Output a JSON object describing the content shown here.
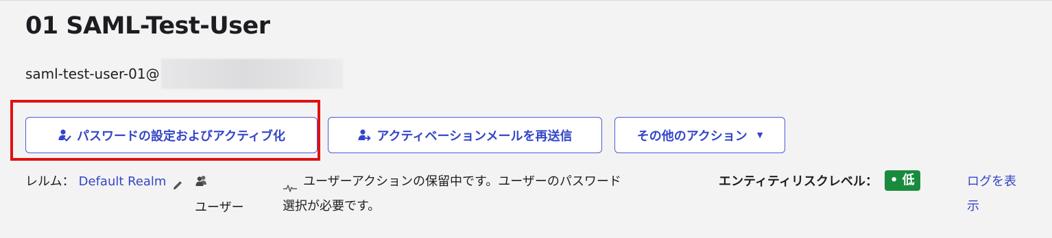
{
  "user": {
    "title": "01 SAML-Test-User",
    "email_prefix": "saml-test-user-01@"
  },
  "actions": {
    "set_password_label": "パスワードの設定およびアクティブ化",
    "resend_activation_label": "アクティベーションメールを再送信",
    "other_actions_label": "その他のアクション",
    "other_actions_caret": "▼"
  },
  "details": {
    "realm_label": "レルム：",
    "realm_value": "Default Realm",
    "user_type": "ユーザー",
    "pending_message": "ユーザーアクションの保留中です。ユーザーのパスワード選択が必要です。",
    "risk_label": "エンティティリスクレベル：",
    "risk_value": "• 低",
    "view_log_label": "ログを表示"
  },
  "colors": {
    "accent": "#3345c6",
    "highlight": "#e01010",
    "risk_low": "#1a8b3e",
    "background": "#f3f3f3"
  },
  "icons": {
    "set_password": "user-check-icon",
    "resend_activation": "user-send-icon",
    "realm_edit": "pencil-icon",
    "user_type": "users-icon",
    "pending": "activity-pulse-icon"
  }
}
